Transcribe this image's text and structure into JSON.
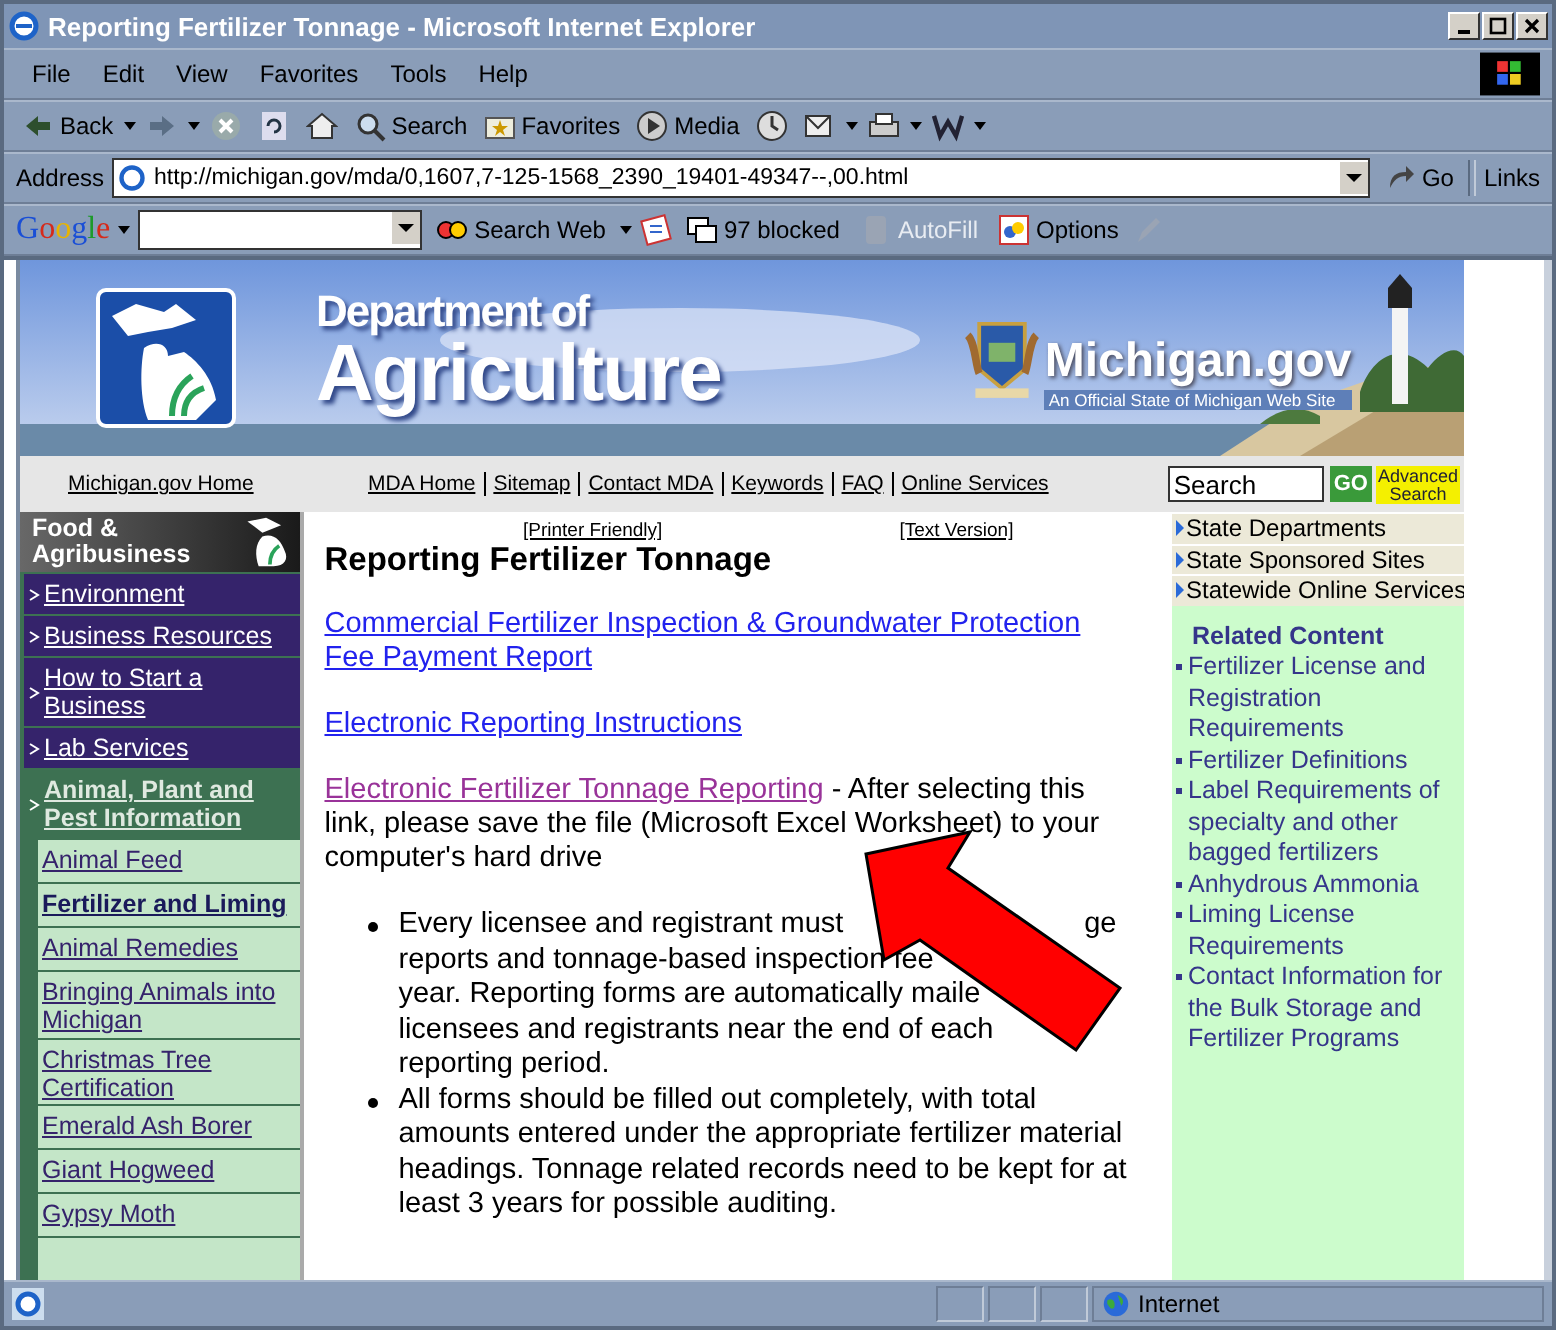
{
  "window": {
    "title": "Reporting Fertilizer Tonnage - Microsoft Internet Explorer"
  },
  "menu": [
    "File",
    "Edit",
    "View",
    "Favorites",
    "Tools",
    "Help"
  ],
  "toolbar": [
    {
      "kind": "back",
      "label": "Back"
    },
    {
      "kind": "forward"
    },
    {
      "kind": "stop"
    },
    {
      "kind": "refresh"
    },
    {
      "kind": "home"
    },
    {
      "kind": "search",
      "label": "Search"
    },
    {
      "kind": "favorites",
      "label": "Favorites"
    },
    {
      "kind": "media",
      "label": "Media"
    },
    {
      "kind": "history"
    },
    {
      "kind": "mail"
    },
    {
      "kind": "print"
    },
    {
      "kind": "word"
    }
  ],
  "address": {
    "label": "Address",
    "url": "http://michigan.gov/mda/0,1607,7-125-1568_2390_19401-49347--,00.html",
    "go": "Go",
    "links": "Links"
  },
  "google_bar": {
    "logo": "Google",
    "search_web": "Search Web",
    "blocked": "97 blocked",
    "autofill": "AutoFill",
    "autofill_disabled": true,
    "options": "Options"
  },
  "banner": {
    "dept_line1": "Department of",
    "dept_line2": "Agriculture",
    "portal": "Michigan.gov",
    "tagline": "An Official State of Michigan Web Site"
  },
  "nav": {
    "home": "Michigan.gov Home",
    "links": [
      "MDA Home",
      "Sitemap",
      "Contact MDA",
      "Keywords",
      "FAQ",
      "Online Services"
    ],
    "search_value": "Search",
    "go": "GO",
    "advanced": "Advanced Search"
  },
  "left_nav": {
    "heading": "Food & Agribusiness",
    "items": [
      {
        "label": "Environment",
        "expanded": false
      },
      {
        "label": "Business Resources",
        "expanded": false
      },
      {
        "label": "How to Start a Business",
        "expanded": false
      },
      {
        "label": "Lab Services",
        "expanded": false
      },
      {
        "label": "Animal, Plant and Pest Information",
        "expanded": true,
        "children": [
          {
            "label": "Animal Feed",
            "selected": false
          },
          {
            "label": "Fertilizer and Liming",
            "selected": true
          },
          {
            "label": "Animal Remedies",
            "selected": false
          },
          {
            "label": "Bringing Animals into Michigan",
            "selected": false
          },
          {
            "label": "Christmas Tree Certification",
            "selected": false
          },
          {
            "label": "Emerald Ash Borer",
            "selected": false
          },
          {
            "label": "Giant Hogweed",
            "selected": false
          },
          {
            "label": "Gypsy Moth",
            "selected": false
          }
        ]
      }
    ]
  },
  "content": {
    "printer": "[Printer Friendly]",
    "text_version": "[Text Version]",
    "title": "Reporting Fertilizer Tonnage",
    "links": [
      {
        "text": "Commercial Fertilizer Inspection & Groundwater Protection Fee Payment Report",
        "visited": false
      },
      {
        "text": "Electronic Reporting Instructions",
        "visited": false
      },
      {
        "text": "Electronic Fertilizer Tonnage Reporting",
        "visited": true,
        "note": " - After selecting this link, please save the file (Microsoft Excel Worksheet) to your computer's hard drive"
      }
    ],
    "bullets": [
      {
        "kind": "lines",
        "lines": [
          [
            "Every licensee and registrant must",
            "ge"
          ],
          [
            "reports and tonnage-based inspection fee"
          ],
          [
            "year. Reporting forms are automatically maile"
          ],
          [
            "licensees and registrants near the end of each"
          ],
          [
            "reporting period."
          ]
        ]
      },
      {
        "kind": "text",
        "text": "All forms should be filled out completely, with total amounts entered under the appropriate fertilizer material headings. Tonnage related records need to be kept for at least 3 years for possible auditing."
      }
    ]
  },
  "right": {
    "state_links": [
      "State Departments",
      "State Sponsored Sites",
      "Statewide Online Services"
    ],
    "related_heading": "Related Content",
    "related": [
      "Fertilizer License and Registration Requirements",
      "Fertilizer Definitions",
      "Label Requirements of specialty and other bagged fertilizers",
      "Anhydrous Ammonia",
      "Liming License Requirements",
      "Contact Information for the Bulk Storage and Fertilizer Programs"
    ]
  },
  "status_bar": {
    "zone": "Internet"
  }
}
